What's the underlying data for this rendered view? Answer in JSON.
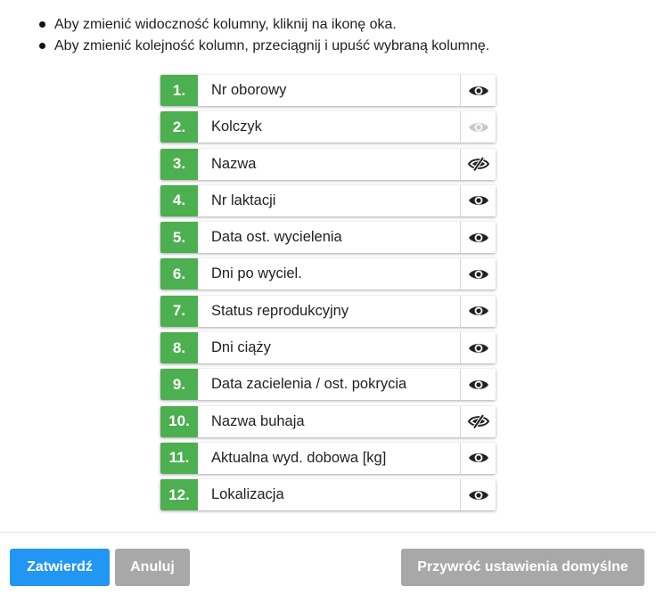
{
  "instructions": [
    "Aby zmienić widoczność kolumny, kliknij na ikonę oka.",
    "Aby zmienić kolejność kolumn, przeciągnij i upuść wybraną kolumnę."
  ],
  "columns": [
    {
      "num": "1.",
      "label": "Nr oborowy",
      "visibility": "visible"
    },
    {
      "num": "2.",
      "label": "Kolczyk",
      "visibility": "locked"
    },
    {
      "num": "3.",
      "label": "Nazwa",
      "visibility": "hidden"
    },
    {
      "num": "4.",
      "label": "Nr laktacji",
      "visibility": "visible"
    },
    {
      "num": "5.",
      "label": "Data ost. wycielenia",
      "visibility": "visible"
    },
    {
      "num": "6.",
      "label": "Dni po wyciel.",
      "visibility": "visible"
    },
    {
      "num": "7.",
      "label": "Status reprodukcyjny",
      "visibility": "visible"
    },
    {
      "num": "8.",
      "label": "Dni ciąży",
      "visibility": "visible"
    },
    {
      "num": "9.",
      "label": "Data zacielenia / ost. pokrycia",
      "visibility": "visible"
    },
    {
      "num": "10.",
      "label": "Nazwa buhaja",
      "visibility": "hidden"
    },
    {
      "num": "11.",
      "label": "Aktualna wyd. dobowa [kg]",
      "visibility": "visible"
    },
    {
      "num": "12.",
      "label": "Lokalizacja",
      "visibility": "visible"
    }
  ],
  "buttons": {
    "confirm": "Zatwierdź",
    "cancel": "Anuluj",
    "reset": "Przywróć ustawienia domyślne"
  },
  "colors": {
    "number_badge": "#4caf50",
    "confirm_button": "#2196f3",
    "secondary_button": "#a8a8a8",
    "eye_visible": "#222222",
    "eye_locked": "#c2c9d1"
  },
  "icons": {
    "visible": "eye-icon",
    "hidden": "eye-slash-icon",
    "locked": "eye-disabled-icon"
  }
}
